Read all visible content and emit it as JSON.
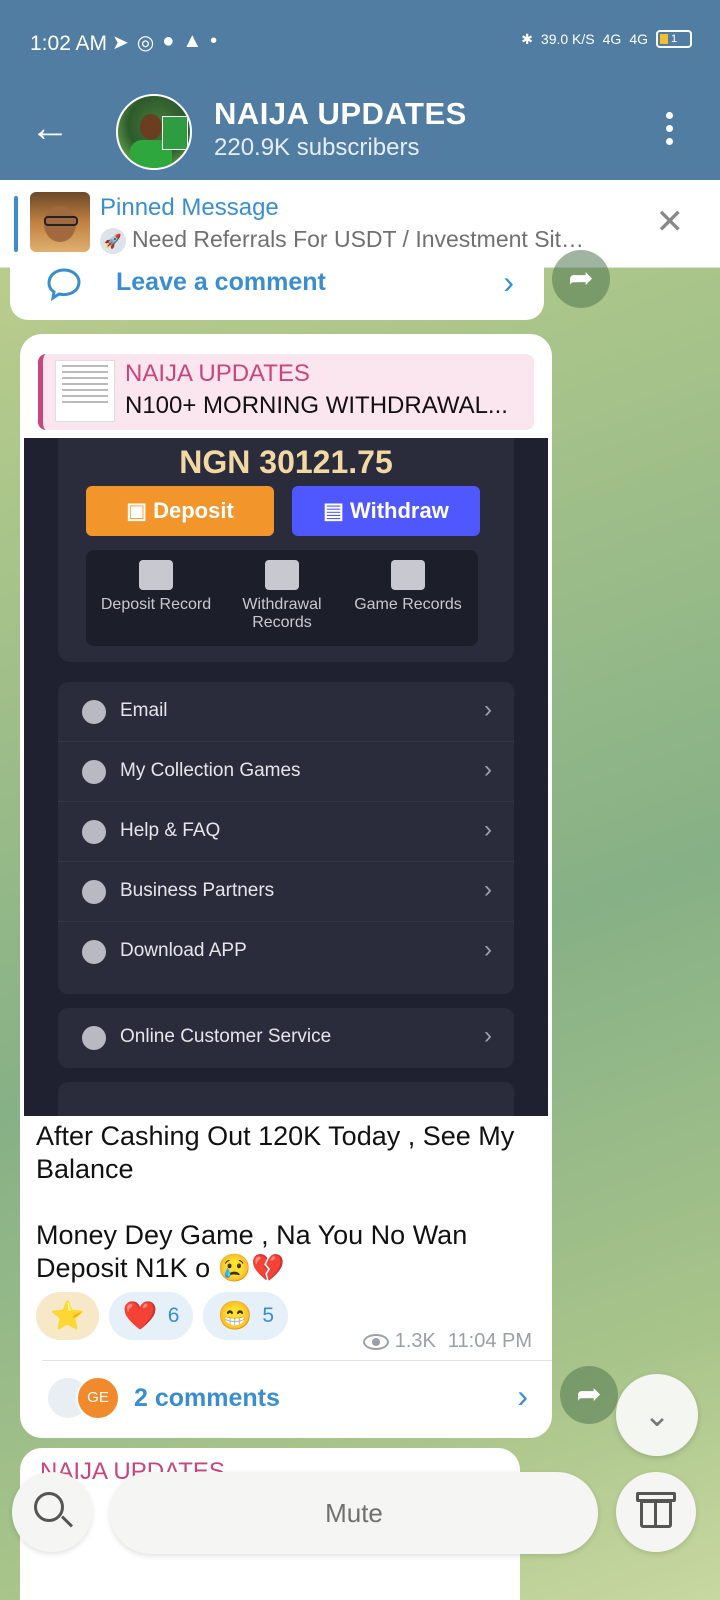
{
  "status_bar": {
    "time": "1:02 AM",
    "icons_left": [
      "telegram-icon",
      "whatsapp-icon",
      "chat-icon",
      "warning-icon",
      "dot-icon"
    ],
    "net_speed": "39.0 K/S",
    "net1": "4G",
    "net2": "4G",
    "battery": "1"
  },
  "header": {
    "title": "NAIJA UPDATES",
    "subtitle": "220.9K subscribers"
  },
  "pinned": {
    "title": "Pinned Message",
    "text": "Need Referrals For USDT / Investment Sit…"
  },
  "prev_message": {
    "comment_label": "Leave a comment"
  },
  "message": {
    "reply": {
      "name": "NAIJA UPDATES",
      "text": "N100+ MORNING WITHDRAWAL..."
    },
    "screenshot": {
      "balance": "NGN 30121.75",
      "deposit_label": "Deposit",
      "withdraw_label": "Withdraw",
      "records": [
        "Deposit Record",
        "Withdrawal Records",
        "Game Records"
      ],
      "menu": [
        "Email",
        "My Collection Games",
        "Help & FAQ",
        "Business Partners",
        "Download APP"
      ],
      "customer_service": "Online Customer Service"
    },
    "caption_line1": "After Cashing Out 120K Today , See My Balance",
    "caption_line2": "Money Dey Game , Na You No Wan Deposit N1K o 😢💔",
    "reactions": [
      {
        "emoji": "⭐",
        "count": ""
      },
      {
        "emoji": "❤️",
        "count": "6"
      },
      {
        "emoji": "😁",
        "count": "5"
      }
    ],
    "views": "1.3K",
    "time": "11:04 PM",
    "comments_label": "2 comments",
    "commenter_initials": "GE"
  },
  "next_message": {
    "name": "NAIJA UPDATES"
  },
  "bottom_bar": {
    "mute_label": "Mute"
  }
}
